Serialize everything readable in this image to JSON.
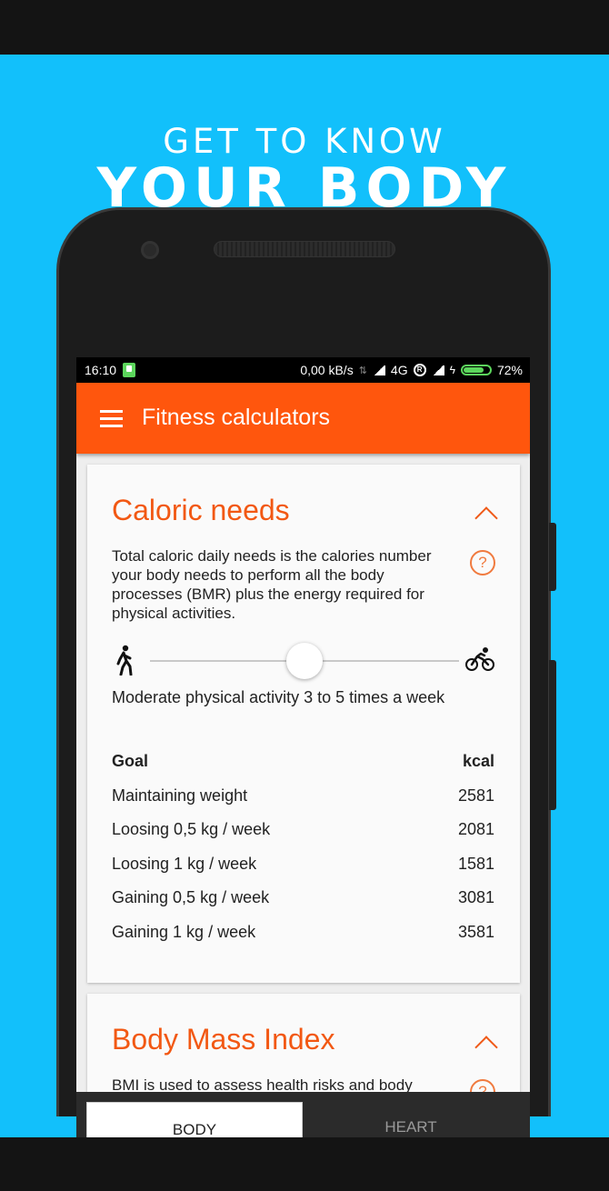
{
  "promo": {
    "line1": "GET TO KNOW",
    "line2": "YOUR BODY"
  },
  "status_bar": {
    "time": "16:10",
    "speed": "0,00 kB/s",
    "network": "4G",
    "battery": "72%"
  },
  "app_bar": {
    "title": "Fitness calculators"
  },
  "caloric_card": {
    "title": "Caloric needs",
    "description": "Total caloric daily needs is the calories number your body needs to perform all the body processes (BMR) plus the energy required for physical activities.",
    "help_symbol": "?",
    "activity_text": "Moderate physical activity 3 to 5 times a week",
    "slider_level": 0.5,
    "table_header": {
      "goal": "Goal",
      "unit": "kcal"
    },
    "rows": [
      {
        "goal": "Maintaining weight",
        "kcal": "2581"
      },
      {
        "goal": "Loosing 0,5 kg / week",
        "kcal": "2081"
      },
      {
        "goal": "Loosing 1 kg / week",
        "kcal": "1581"
      },
      {
        "goal": "Gaining 0,5 kg / week",
        "kcal": "3081"
      },
      {
        "goal": "Gaining 1 kg / week",
        "kcal": "3581"
      }
    ]
  },
  "bmi_card": {
    "title": "Body Mass Index",
    "description": "BMI is used to assess health risks and body",
    "help_symbol": "?"
  },
  "tabs": {
    "body": "BODY",
    "heart": "HEART"
  },
  "colors": {
    "background": "#12c0fb",
    "accent": "#ff560d",
    "title": "#f25813"
  }
}
